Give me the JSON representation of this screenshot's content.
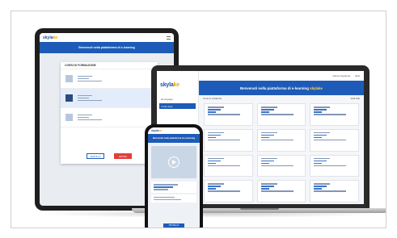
{
  "tablet": {
    "logo_main": "skyla",
    "logo_accent": "ke",
    "banner": "Benvenuti nella piattaforma di e-learning",
    "modal_title": "CORSI DI FORMAZIONE",
    "cancel_label": "ANNULLA",
    "enter_label": "ENTRA"
  },
  "laptop": {
    "logo_main": "skyla",
    "logo_accent": "ke",
    "nav": [
      "Homepage",
      "I miei corsi"
    ],
    "top_links": [
      "Nome Cognome",
      "Esci"
    ],
    "banner": "Benvenuti nella piattaforma di e-learning",
    "banner_accent": "skylake",
    "filter_left": "Corsi in evidenza",
    "filter_right": "Vedi tutti"
  },
  "phone": {
    "logo_main": "skyla",
    "logo_accent": "ke",
    "banner": "Benvenuti nella piattaforma di e-learning",
    "button": "PROSEGUI"
  }
}
